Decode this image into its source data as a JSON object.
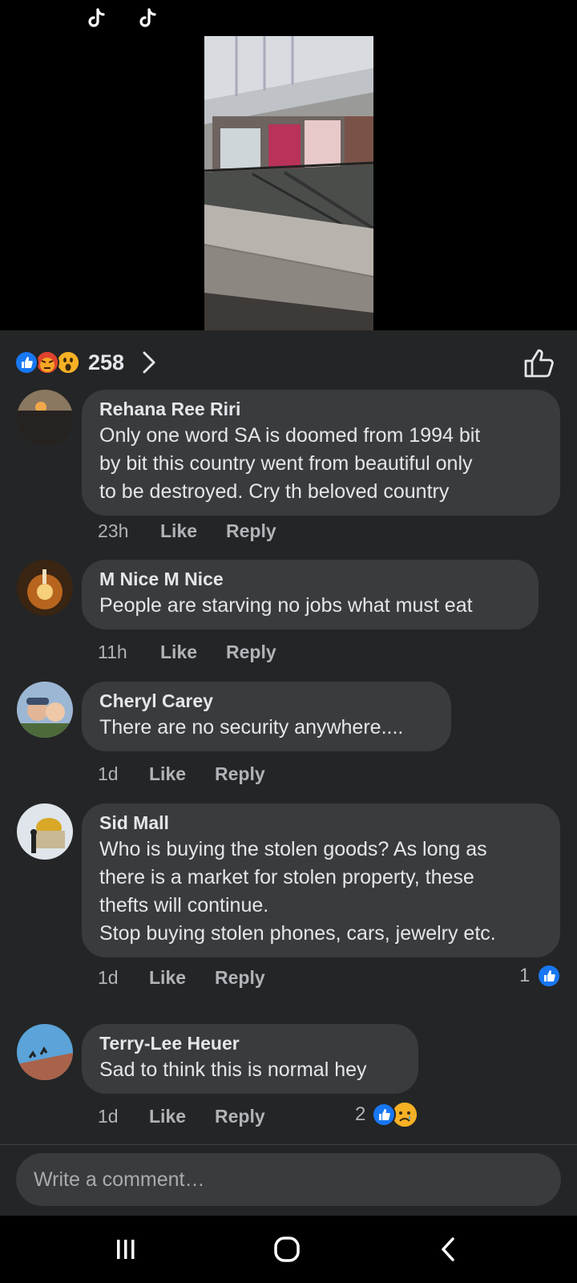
{
  "post": {
    "reactions_total": "258",
    "reactions": [
      "like-icon",
      "angry-icon",
      "wow-icon"
    ]
  },
  "comments": [
    {
      "author": "Rehana Ree Riri",
      "text": "Only one word SA is doomed from 1994 bit\nby bit this country went from beautiful only\nto be destroyed. Cry th beloved country",
      "time": "23h",
      "like_label": "Like",
      "reply_label": "Reply"
    },
    {
      "author": "M Nice M Nice",
      "text": "People are starving no jobs what must eat",
      "time": "11h",
      "like_label": "Like",
      "reply_label": "Reply"
    },
    {
      "author": "Cheryl Carey",
      "text": "There are no security anywhere....",
      "time": "1d",
      "like_label": "Like",
      "reply_label": "Reply"
    },
    {
      "author": "Sid Mall",
      "text": "Who is buying the stolen goods? As long as\nthere is a market for stolen property,  these\nthefts will continue.\nStop buying stolen phones, cars,  jewelry etc.",
      "time": "1d",
      "like_label": "Like",
      "reply_label": "Reply",
      "reaction_count": "1",
      "reactions": [
        "like-icon"
      ]
    },
    {
      "author": "Terry-Lee Heuer",
      "text": "Sad to think this is normal hey",
      "time": "1d",
      "like_label": "Like",
      "reply_label": "Reply",
      "reaction_count": "2",
      "reactions": [
        "like-icon",
        "sad-icon"
      ]
    }
  ],
  "composer": {
    "placeholder": "Write a comment…"
  },
  "colors": {
    "panel": "#242526",
    "bubble": "#3a3b3c",
    "like_blue": "#1877f2",
    "meta_text": "#b0b3b8"
  }
}
